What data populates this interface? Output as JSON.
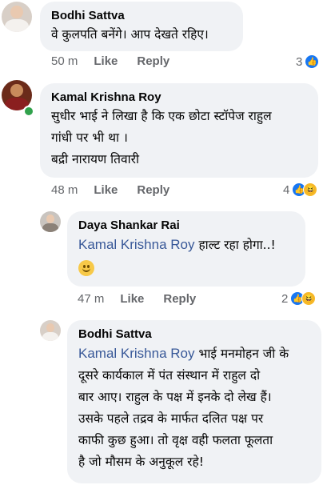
{
  "comments": [
    {
      "author": "Bodhi Sattva",
      "lines": [
        "वे कुलपति बनेंगे। आप देखते रहिए।"
      ],
      "time": "50 m",
      "like_label": "Like",
      "reply_label": "Reply",
      "reaction_count": "3",
      "reactions": [
        "like-icon"
      ]
    },
    {
      "author": "Kamal Krishna Roy",
      "lines": [
        "सुधीर भाई ने लिखा है कि एक छोटा स्टॉपेज राहुल",
        "गांधी पर भी था ।",
        "बद्री नारायण तिवारी"
      ],
      "time": "48 m",
      "like_label": "Like",
      "reply_label": "Reply",
      "reaction_count": "4",
      "reactions": [
        "like-icon",
        "haha-icon"
      ]
    },
    {
      "author": "Daya Shankar Rai",
      "mention": "Kamal Krishna Roy",
      "text_after_mention": " हाल्ट रहा होगा..!",
      "emoji": "smile-emoji",
      "time": "47 m",
      "like_label": "Like",
      "reply_label": "Reply",
      "reaction_count": "2",
      "reactions": [
        "like-icon",
        "haha-icon"
      ]
    },
    {
      "author": "Bodhi Sattva",
      "mention": "Kamal Krishna Roy",
      "text_after_mention": " भाई मनमोहन जी के",
      "lines": [
        "दूसरे कार्यकाल में पंत संस्थान में राहुल दो",
        "बार आए। राहुल के पक्ष में इनके दो लेख हैं।",
        "उसके पहले तद्रव के मार्फत दलित पक्ष पर",
        "काफी कुछ हुआ। तो वृक्ष वही फलता फूलता",
        "है जो मौसम के अनुकूल रहे!"
      ]
    }
  ],
  "colors": {
    "bubble": "#f0f2f5",
    "meta": "#65676b",
    "mention": "#385898",
    "like": "#1877f2",
    "haha": "#f7b928"
  }
}
